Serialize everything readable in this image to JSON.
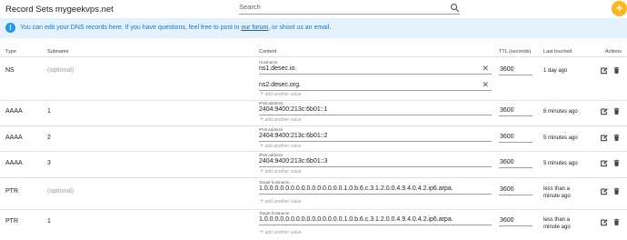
{
  "header": {
    "title": "Record Sets mygeekvps.net",
    "search_placeholder": "Search",
    "add_button": "+"
  },
  "banner": {
    "icon": "i",
    "text_before": "You can edit your DNS records here. If you have questions, feel free to post in ",
    "link_forum": "our forum",
    "text_after": ", or shoot us an email."
  },
  "columns": {
    "type": "Type",
    "subname": "Subname",
    "content": "Content",
    "ttl": "TTL (seconds)",
    "last_touched": "Last touched",
    "actions": "Actions"
  },
  "add_value_label": "add another value",
  "records": [
    {
      "type": "NS",
      "subname": "(optional)",
      "content_label": "Hostname",
      "values": [
        "ns1.desec.io.",
        "ns2.desec.org."
      ],
      "ttl": "3600",
      "touched": "1 day ago"
    },
    {
      "type": "AAAA",
      "subname": "1",
      "content_label": "IPv6 address",
      "values": [
        "2404:9400:213c:6b01::1"
      ],
      "ttl": "3600",
      "touched": "6 minutes ago"
    },
    {
      "type": "AAAA",
      "subname": "2",
      "content_label": "IPv6 address",
      "values": [
        "2404:9400:213c:6b01::2"
      ],
      "ttl": "3600",
      "touched": "5 minutes ago"
    },
    {
      "type": "AAAA",
      "subname": "3",
      "content_label": "IPv6 address",
      "values": [
        "2404:9400:213c:6b01::3"
      ],
      "ttl": "3600",
      "touched": "5 minutes ago"
    },
    {
      "type": "PTR",
      "subname": "(optional)",
      "content_label": "Target hostname",
      "values": [
        "1.0.0.0.0.0.0.0.0.0.0.0.0.0.0.0.1.0.b.6.c.3.1.2.0.0.4.9.4.0.4.2.ip6.arpa."
      ],
      "ttl": "3600",
      "touched": "less than a minute ago"
    },
    {
      "type": "PTR",
      "subname": "1",
      "content_label": "Target hostname",
      "values": [
        "1.0.0.0.0.0.0.0.0.0.0.0.0.0.0.0.1.0.b.6.c.3.1.2.0.0.4.9.4.0.4.2.ip6.arpa."
      ],
      "ttl": "3600",
      "touched": "less than a minute ago"
    }
  ],
  "colors": {
    "accent": "#fbb718",
    "banner_bg": "#e3f2fd",
    "banner_text": "#1976d2"
  },
  "icons": {
    "search": "search-icon",
    "info": "info-icon",
    "clear": "close-icon",
    "edit": "edit-icon",
    "delete": "trash-icon"
  }
}
